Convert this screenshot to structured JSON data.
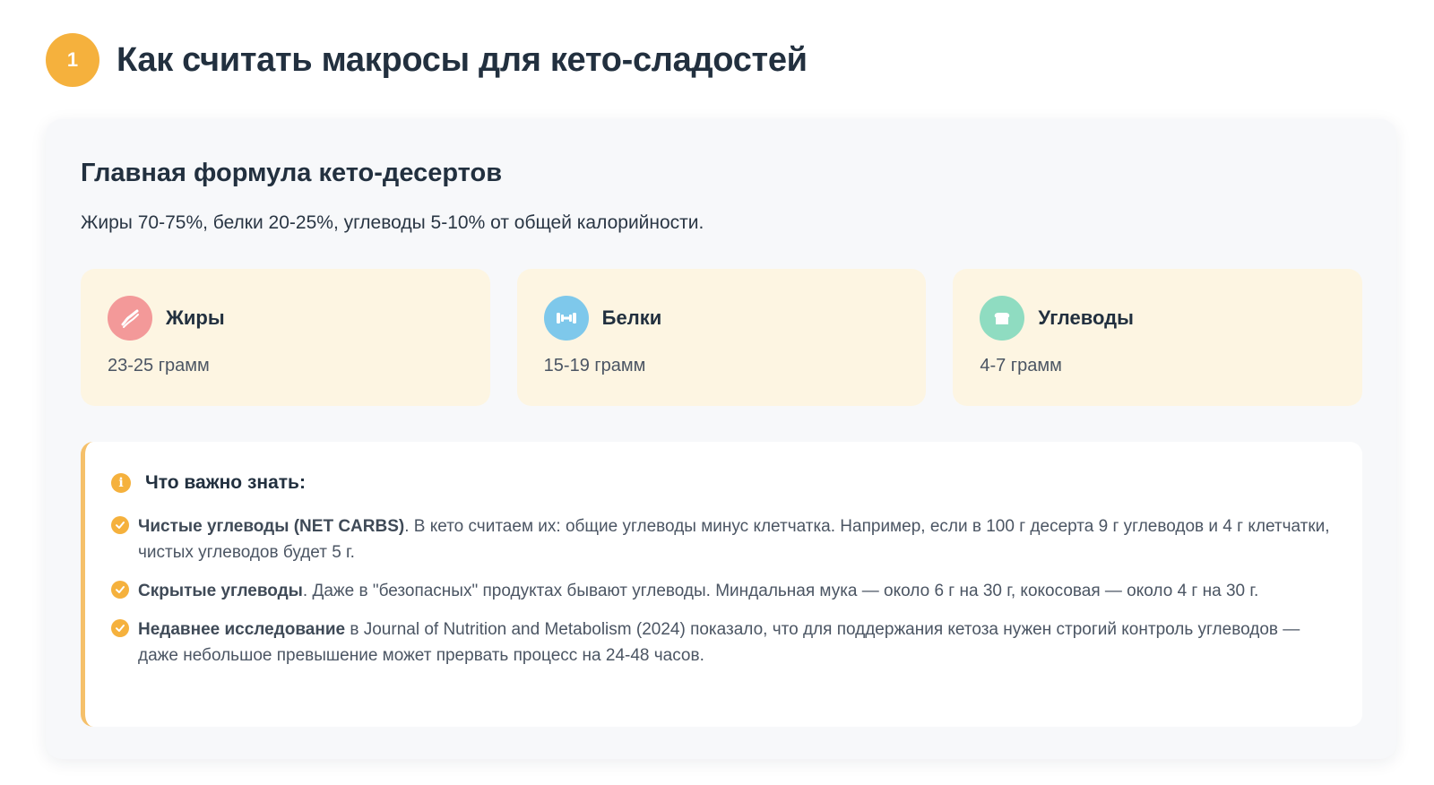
{
  "header": {
    "step_number": "1",
    "title": "Как считать макросы для кето-сладостей"
  },
  "card": {
    "title": "Главная формула кето-десертов",
    "subtitle": "Жиры 70-75%, белки 20-25%, углеводы 5-10% от общей калорийности."
  },
  "macros": [
    {
      "name": "Жиры",
      "amount": "23-25 грамм",
      "icon": "bacon-icon",
      "color": "#f39999"
    },
    {
      "name": "Белки",
      "amount": "15-19 грамм",
      "icon": "dumbbell-icon",
      "color": "#7ec8eb"
    },
    {
      "name": "Углеводы",
      "amount": "4-7 грамм",
      "icon": "bread-icon",
      "color": "#8fdcc1"
    }
  ],
  "info": {
    "icon": "info-icon",
    "title": "Что важно знать:",
    "items": [
      {
        "bold": "Чистые углеводы (NET CARBS)",
        "text": ". В кето считаем их: общие углеводы минус клетчатка. Например, если в 100 г десерта 9 г углеводов и 4 г клетчатки, чистых углеводов будет 5 г."
      },
      {
        "bold": "Скрытые углеводы",
        "text": ". Даже в \"безопасных\" продуктах бывают углеводы. Миндальная мука — около 6 г на 30 г, кокосовая — около 4 г на 30 г."
      },
      {
        "bold": "Недавнее исследование",
        "text": " в Journal of Nutrition and Metabolism (2024) показало, что для поддержания кетоза нужен строгий контроль углеводов — даже небольшое превышение может прервать процесс на 24-48 часов."
      }
    ]
  },
  "colors": {
    "accent": "#f5b13d",
    "macro_card_bg": "#fdf5e2",
    "info_border": "#f5c06a"
  }
}
